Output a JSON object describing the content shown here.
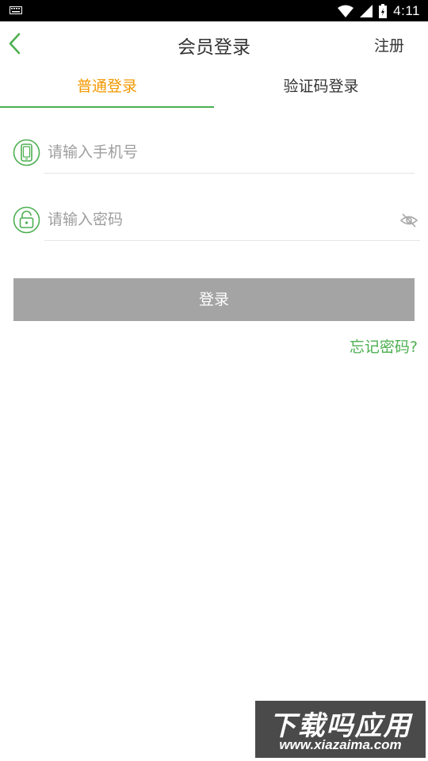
{
  "status_bar": {
    "time": "4:11"
  },
  "header": {
    "title": "会员登录",
    "register_label": "注册"
  },
  "tabs": [
    {
      "label": "普通登录",
      "active": true
    },
    {
      "label": "验证码登录",
      "active": false
    }
  ],
  "form": {
    "phone": {
      "placeholder": "请输入手机号",
      "value": ""
    },
    "password": {
      "placeholder": "请输入密码",
      "value": ""
    },
    "login_label": "登录",
    "forgot_label": "忘记密码?"
  },
  "watermark": {
    "title": "下载吗应用",
    "url": "www.xiazaima.com"
  },
  "colors": {
    "accent_green": "#4caf50",
    "active_tab_orange": "#f39800",
    "disabled_button": "#a4a4a4",
    "text": "#333333",
    "placeholder": "#9e9e9e"
  },
  "icons": {
    "back": "chevron-left-icon",
    "phone": "phone-icon",
    "lock": "unlock-icon",
    "eye": "eye-off-icon"
  }
}
